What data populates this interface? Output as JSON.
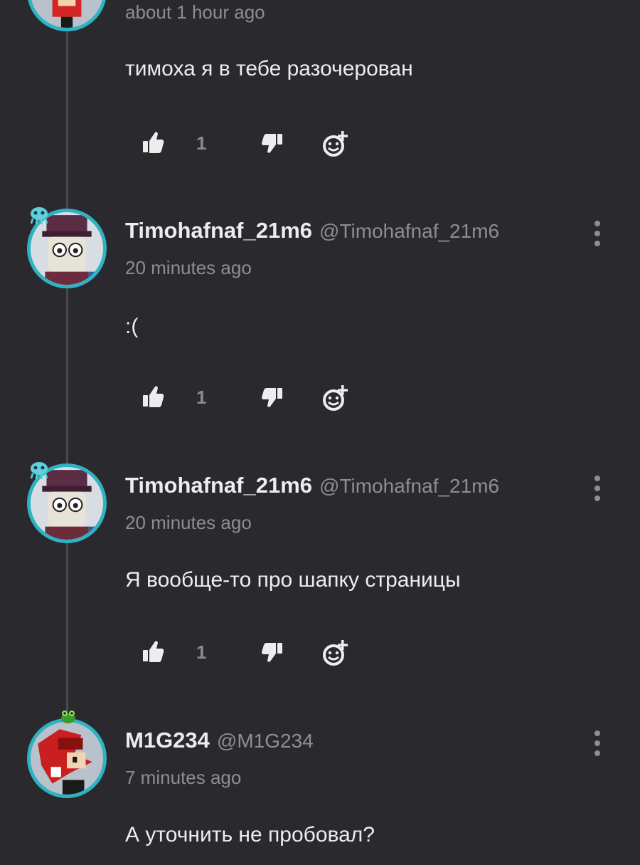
{
  "comments": [
    {
      "timestamp": "about 1 hour ago",
      "text": "тимоха я в тебе разочерован",
      "likes": "1"
    },
    {
      "username": "Timohafnaf_21m6",
      "handle": "@Timohafnaf_21m6",
      "timestamp": "20 minutes ago",
      "text": ":(",
      "likes": "1"
    },
    {
      "username": "Timohafnaf_21m6",
      "handle": "@Timohafnaf_21m6",
      "timestamp": "20 minutes ago",
      "text": "Я вообще-то про шапку страницы",
      "likes": "1"
    },
    {
      "username": "M1G234",
      "handle": "@M1G234",
      "timestamp": "7 minutes ago",
      "text": "А уточнить не пробовал?"
    }
  ],
  "icons": {
    "like": "thumbs-up-icon",
    "dislike": "thumbs-down-icon",
    "react": "add-reaction-icon",
    "more": "more-vertical-icon"
  },
  "colors": {
    "background": "#2a292e",
    "avatar_ring": "#2fb2c2",
    "text_primary": "#ededee",
    "text_secondary": "#8e8d93"
  }
}
